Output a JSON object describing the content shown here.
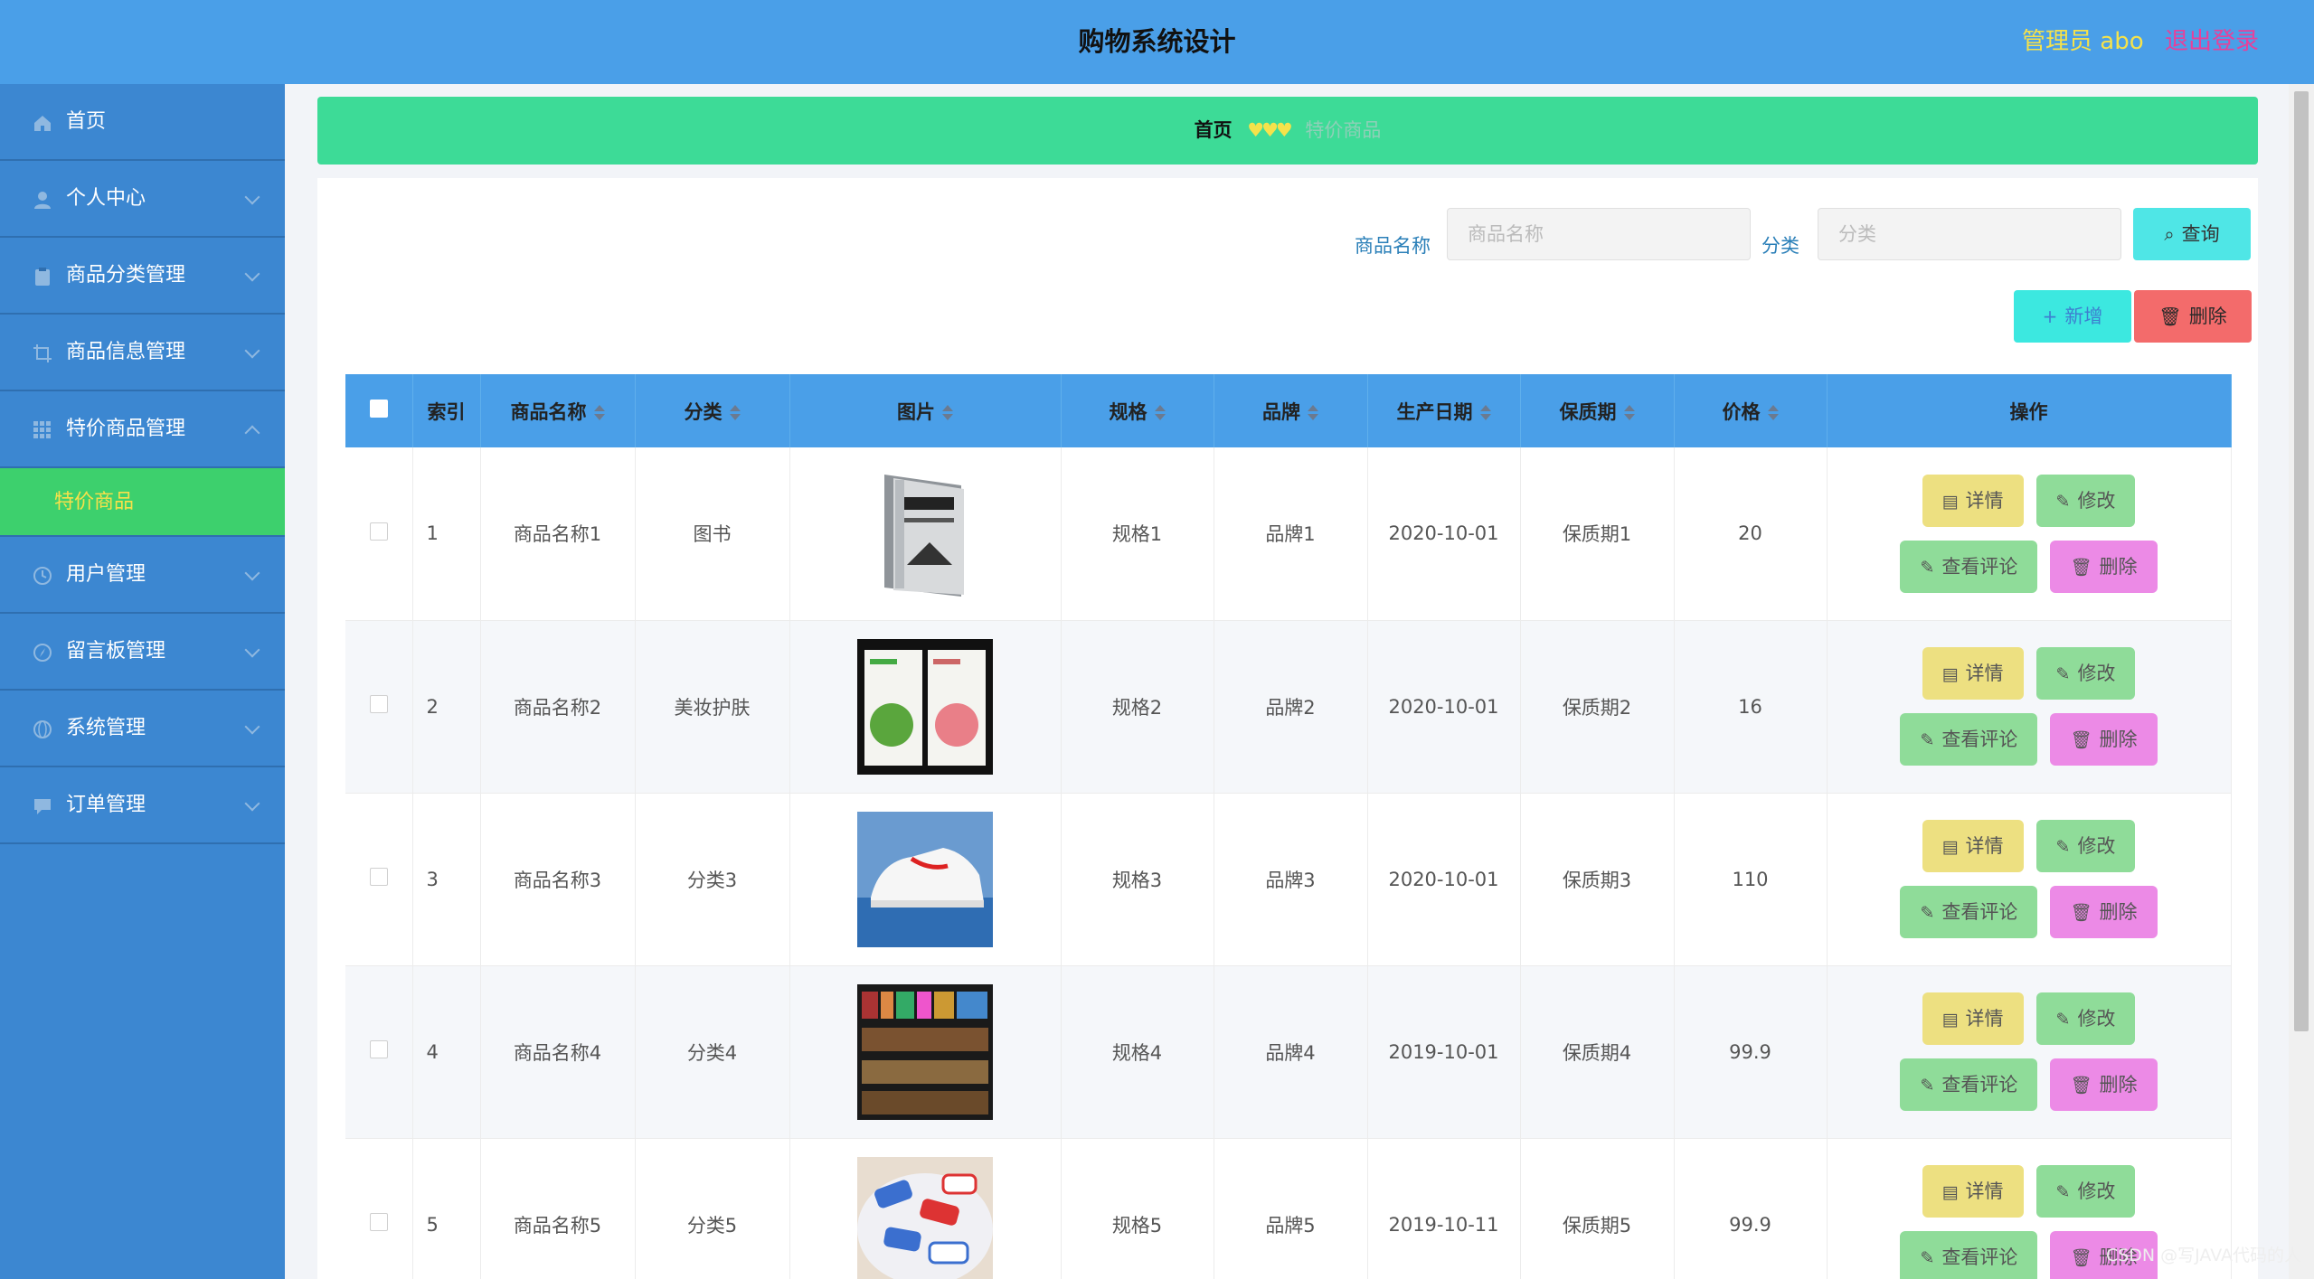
{
  "header": {
    "title": "购物系统设计",
    "admin_label": "管理员 abo",
    "logout_label": "退出登录"
  },
  "sidebar": {
    "items": [
      {
        "label": "首页",
        "icon": "home-icon",
        "expandable": false
      },
      {
        "label": "个人中心",
        "icon": "user-icon",
        "expandable": true
      },
      {
        "label": "商品分类管理",
        "icon": "clipboard-icon",
        "expandable": true
      },
      {
        "label": "商品信息管理",
        "icon": "crop-icon",
        "expandable": true
      },
      {
        "label": "特价商品管理",
        "icon": "grid-icon",
        "expandable": true,
        "expanded": true,
        "sub": "特价商品"
      },
      {
        "label": "用户管理",
        "icon": "clock-icon",
        "expandable": true
      },
      {
        "label": "留言板管理",
        "icon": "compass-icon",
        "expandable": true
      },
      {
        "label": "系统管理",
        "icon": "globe-icon",
        "expandable": true
      },
      {
        "label": "订单管理",
        "icon": "chat-icon",
        "expandable": true
      }
    ]
  },
  "breadcrumb": {
    "home": "首页",
    "separator": "♥♥♥",
    "current": "特价商品"
  },
  "search": {
    "name_label": "商品名称",
    "name_placeholder": "商品名称",
    "category_label": "分类",
    "category_placeholder": "分类",
    "query_label": "查询"
  },
  "actions": {
    "add_label": "新增",
    "delete_label": "删除"
  },
  "table": {
    "headers": [
      "索引",
      "商品名称",
      "分类",
      "图片",
      "规格",
      "品牌",
      "生产日期",
      "保质期",
      "价格",
      "操作"
    ],
    "row_actions": {
      "detail": "详情",
      "edit": "修改",
      "comment": "查看评论",
      "remove": "删除"
    },
    "rows": [
      {
        "index": "1",
        "name": "商品名称1",
        "category": "图书",
        "image": "book-cover",
        "spec": "规格1",
        "brand": "品牌1",
        "date": "2020-10-01",
        "shelf": "保质期1",
        "price": "20"
      },
      {
        "index": "2",
        "name": "商品名称2",
        "category": "美妆护肤",
        "image": "face-mask-pack",
        "spec": "规格2",
        "brand": "品牌2",
        "date": "2020-10-01",
        "shelf": "保质期2",
        "price": "16"
      },
      {
        "index": "3",
        "name": "商品名称3",
        "category": "分类3",
        "image": "white-sneaker",
        "spec": "规格3",
        "brand": "品牌3",
        "date": "2020-10-01",
        "shelf": "保质期3",
        "price": "110"
      },
      {
        "index": "4",
        "name": "商品名称4",
        "category": "分类4",
        "image": "bookshelf",
        "spec": "规格4",
        "brand": "品牌4",
        "date": "2019-10-01",
        "shelf": "保质期4",
        "price": "99.9"
      },
      {
        "index": "5",
        "name": "商品名称5",
        "category": "分类5",
        "image": "candies",
        "spec": "规格5",
        "brand": "品牌5",
        "date": "2019-10-11",
        "shelf": "保质期5",
        "price": "99.9"
      }
    ]
  },
  "watermark": "CSDN @写JAVA代码的人"
}
